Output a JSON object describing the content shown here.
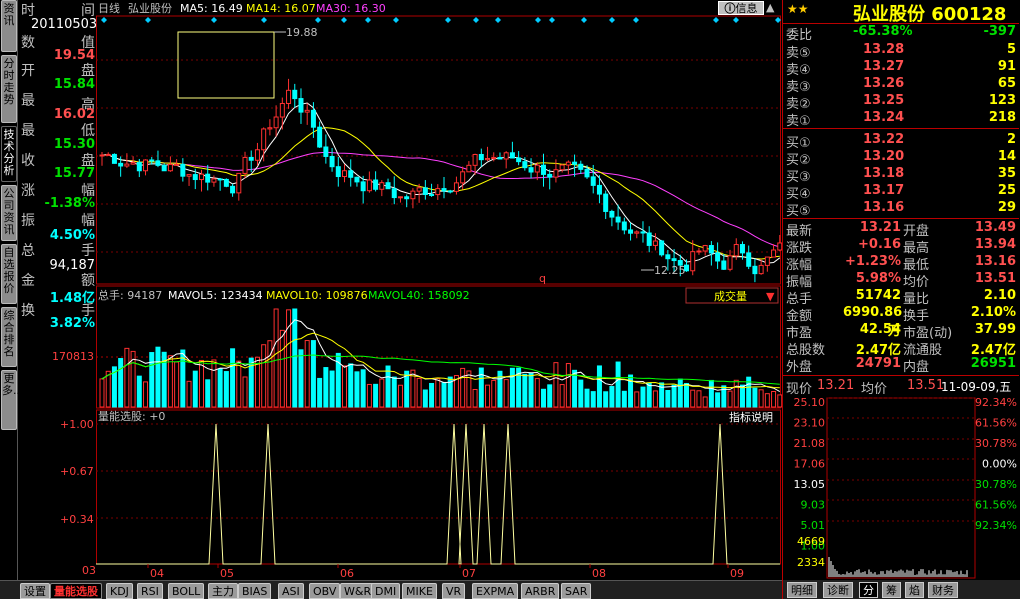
{
  "left_tabs": [
    "资讯",
    "分时走势",
    "技术分析",
    "公司资讯",
    "自选报价",
    "综合排名",
    "更多..."
  ],
  "left_tab_active": 2,
  "header": {
    "period": "日线",
    "stock_name": "弘业股份",
    "ma5": "MA5: 16.49",
    "ma14": "MA14: 16.07",
    "ma30": "MA30: 16.30",
    "info_button": "信息"
  },
  "info_col": {
    "labels": [
      "时间",
      "数值",
      "开盘",
      "最高",
      "最低",
      "收盘",
      "涨幅",
      "振幅",
      "总手",
      "金额",
      "换手"
    ],
    "date": "20110503",
    "open": "19.54",
    "high": "15.84",
    "low": "16.02",
    "close": "15.30",
    "chg": "15.77",
    "amp": "-1.38%",
    "vol": "4.50%",
    "amount": "94,187",
    "turnover": "1.48亿",
    "turn_pct": "3.82%"
  },
  "price_chart": {
    "high_label": "19.88",
    "low_label": "12.25",
    "marker_q": "q"
  },
  "volume_header": {
    "total": "总手: 94187",
    "mavol5": "MAVOL5: 123434",
    "mavol10": "MAVOL10: 109876",
    "mavol40": "MAVOL40: 158092",
    "selector": "成交量",
    "axis_label": "170813"
  },
  "indicator": {
    "title": "量能选股: +0",
    "help": "指标说明",
    "ticks": [
      "+1.00",
      "+0.67",
      "+0.34",
      "03"
    ]
  },
  "x_axis": [
    "04",
    "05",
    "06",
    "07",
    "08",
    "09"
  ],
  "bottom_tabs": [
    "设置",
    "量能选股",
    "KDJ",
    "RSI",
    "BOLL",
    "主力",
    "BIAS",
    "ASI",
    "OBV",
    "W&R",
    "DMI",
    "MIKE",
    "VR",
    "EXPMA",
    "ARBR",
    "SAR"
  ],
  "bottom_tab_active": 1,
  "quote": {
    "title": "弘业股份 600128",
    "weibi_label": "委比",
    "weibi": "-65.38%",
    "weicha": "-397",
    "asks": [
      {
        "label": "卖⑤",
        "price": "13.28",
        "vol": "5"
      },
      {
        "label": "卖④",
        "price": "13.27",
        "vol": "91"
      },
      {
        "label": "卖③",
        "price": "13.26",
        "vol": "65"
      },
      {
        "label": "卖②",
        "price": "13.25",
        "vol": "123"
      },
      {
        "label": "卖①",
        "price": "13.24",
        "vol": "218"
      }
    ],
    "bids": [
      {
        "label": "买①",
        "price": "13.22",
        "vol": "2"
      },
      {
        "label": "买②",
        "price": "13.20",
        "vol": "14"
      },
      {
        "label": "买③",
        "price": "13.18",
        "vol": "35"
      },
      {
        "label": "买④",
        "price": "13.17",
        "vol": "25"
      },
      {
        "label": "买⑤",
        "price": "13.16",
        "vol": "29"
      }
    ],
    "stats": [
      {
        "l1": "最新",
        "v1": "13.21",
        "c1": "red",
        "l2": "开盘",
        "v2": "13.49",
        "c2": "red"
      },
      {
        "l1": "涨跌",
        "v1": "+0.16",
        "c1": "red",
        "l2": "最高",
        "v2": "13.94",
        "c2": "red"
      },
      {
        "l1": "涨幅",
        "v1": "+1.23%",
        "c1": "red",
        "l2": "最低",
        "v2": "13.16",
        "c2": "red"
      },
      {
        "l1": "振幅",
        "v1": "5.98%",
        "c1": "red",
        "l2": "均价",
        "v2": "13.51",
        "c2": "red"
      },
      {
        "l1": "总手",
        "v1": "51742",
        "c1": "yel",
        "l2": "量比",
        "v2": "2.10",
        "c2": "yel"
      },
      {
        "l1": "金额",
        "v1": "6990.86万",
        "c1": "yel",
        "l2": "换手",
        "v2": "2.10%",
        "c2": "yel"
      },
      {
        "l1": "市盈",
        "v1": "42.54",
        "c1": "yel",
        "l2": "市盈(动)",
        "v2": "37.99",
        "c2": "yel"
      },
      {
        "l1": "总股数",
        "v1": "2.47亿",
        "c1": "yel",
        "l2": "流通股",
        "v2": "2.47亿",
        "c2": "yel"
      },
      {
        "l1": "外盘",
        "v1": "24791",
        "c1": "red",
        "l2": "内盘",
        "v2": "26951",
        "c2": "grn"
      }
    ],
    "now_label": "现价",
    "now_val": "13.21",
    "avg_label": "均价",
    "avg_val": "13.51",
    "date": "11-09-09,五"
  },
  "mini_chart": {
    "left_ticks": [
      "25.10",
      "23.10",
      "21.08",
      "17.06",
      "13.05",
      "9.03",
      "5.01",
      "1.00",
      "4669",
      "2334"
    ],
    "right_ticks": [
      "92.34%",
      "61.56%",
      "30.78%",
      "0.00%",
      "30.78%",
      "61.56%",
      "92.34%"
    ]
  },
  "rb_tabs": [
    "明细",
    "诊断",
    "分",
    "筹",
    "焰",
    "财务"
  ],
  "rb_tab_active": 2
}
